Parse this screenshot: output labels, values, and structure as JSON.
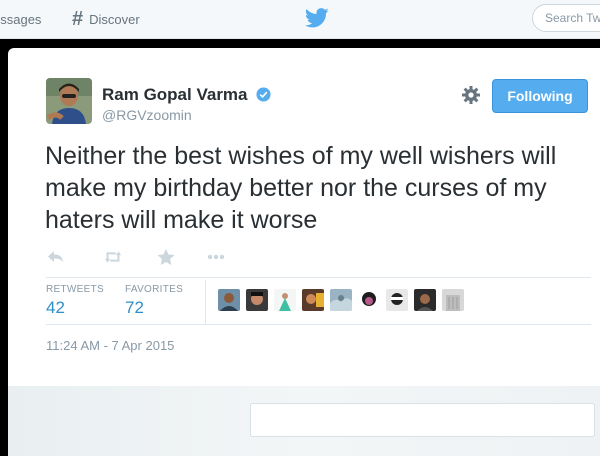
{
  "nav": {
    "messages_label": "essages",
    "discover_label": "Discover",
    "search_placeholder": "Search Tw"
  },
  "tweet": {
    "author_name": "Ram Gopal Varma",
    "author_handle": "@RGVzoomin",
    "follow_label": "Following",
    "text": "Neither the best wishes of my well wishers will make my birthday better nor the curses of my haters will make it worse",
    "retweets_label": "RETWEETS",
    "retweets_count": "42",
    "favorites_label": "FAVORITES",
    "favorites_count": "72",
    "timestamp": "11:24 AM - 7 Apr 2015"
  },
  "colors": {
    "accent": "#55acee",
    "stat_value": "#2d8fc7",
    "muted": "#8899a6",
    "text": "#292f33"
  },
  "icons": [
    "hashtag-icon",
    "twitter-bird-icon",
    "verified-badge-icon",
    "gear-icon",
    "reply-icon",
    "retweet-icon",
    "favorite-icon",
    "more-icon"
  ]
}
